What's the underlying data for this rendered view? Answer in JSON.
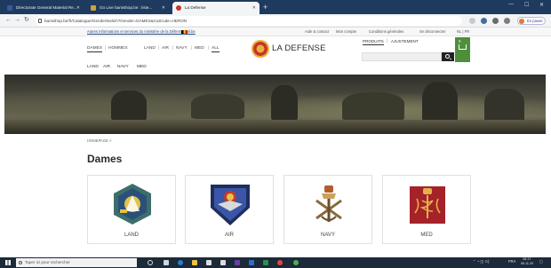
{
  "browser": {
    "tabs": [
      {
        "label": "Directorate General Material Re..."
      },
      {
        "label": "Go Live bamishop.be : liste..."
      },
      {
        "label": "La Defense"
      }
    ],
    "url": "bamishop.be/fr/Catalogue/GenderSwitch?Gender=DAMES&CatCode=HERON",
    "profile_label": "En pause"
  },
  "gov_strip": {
    "notice": "Autres informations et services du ministère de la Défense: mil.be",
    "links": [
      "Aide & contact",
      "Mon compte",
      "Conditions générales",
      "Se déconnecter"
    ],
    "lang": "NL | FR"
  },
  "header": {
    "gender_nav": [
      "DAMES",
      "HOMMES"
    ],
    "category_nav": [
      "LAND",
      "AIR",
      "NAVY",
      "MED",
      "ALL"
    ],
    "sub_nav": [
      "LAND",
      "AIR",
      "NAVY",
      "MED"
    ],
    "brand": "LA DEFENSE",
    "top_right": [
      "PRODUITS",
      "AJUSTEMENT"
    ],
    "cart_count": "0"
  },
  "breadcrumb": "HOMEPAGE >",
  "page_title": "Dames",
  "cards": [
    {
      "label": "LAND",
      "icon": "land-emblem-icon"
    },
    {
      "label": "AIR",
      "icon": "air-emblem-icon"
    },
    {
      "label": "NAVY",
      "icon": "navy-emblem-icon"
    },
    {
      "label": "MED",
      "icon": "med-emblem-icon"
    }
  ],
  "taskbar": {
    "search_placeholder": "Taper ici pour rechercher",
    "lang": "FRA",
    "time": "16:17",
    "date": "06-11-20"
  },
  "colors": {
    "tab_strip": "#1f3a5f",
    "cart_green": "#4e8f3a",
    "taskbar": "#1c2a3a"
  }
}
